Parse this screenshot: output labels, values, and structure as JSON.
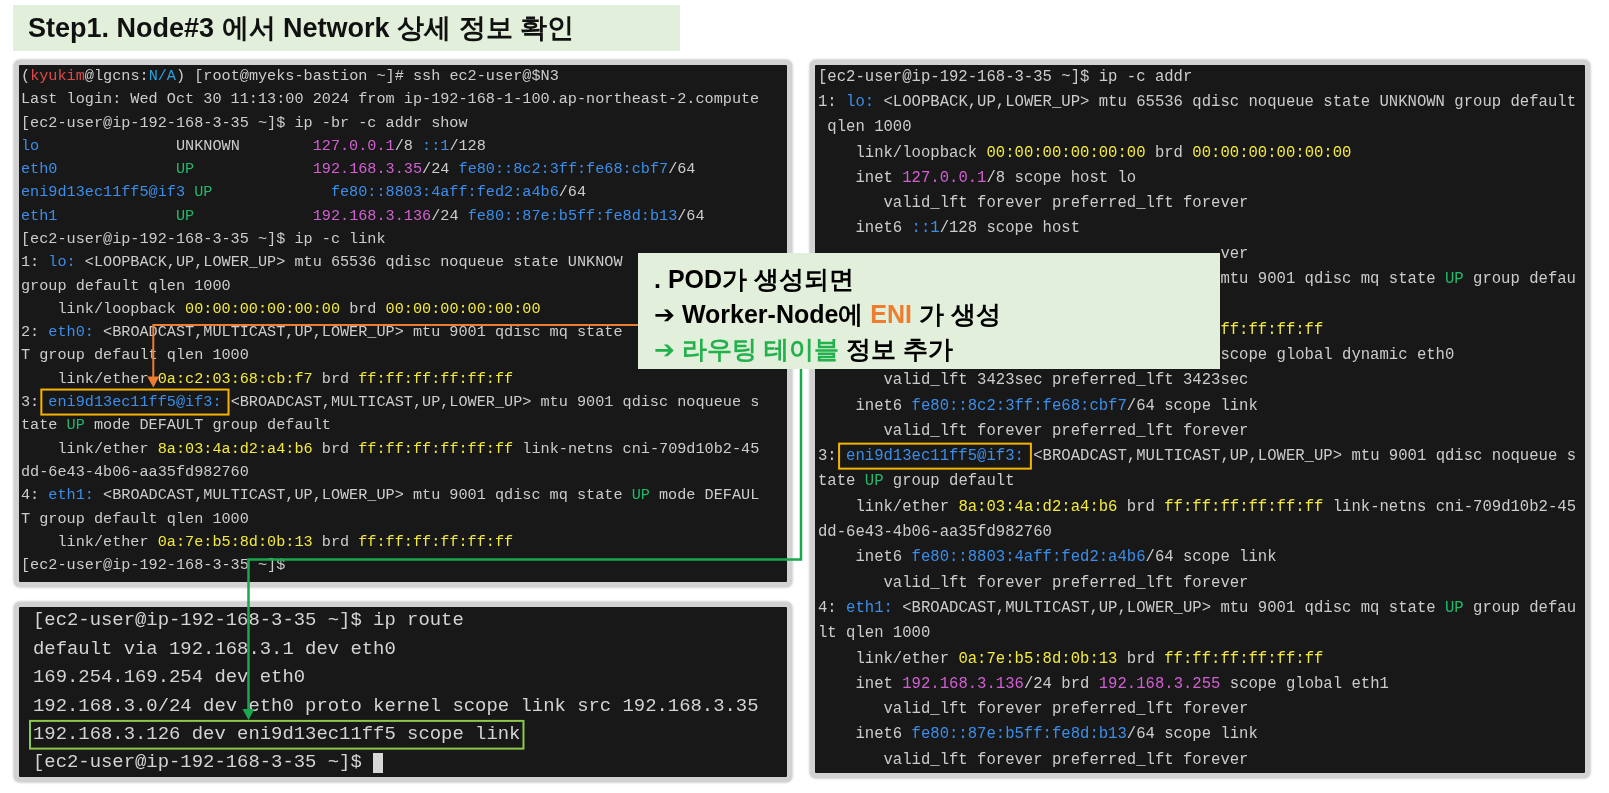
{
  "title": "Step1. Node#3 에서 Network 상세 정보 확인",
  "terminals": [
    {
      "lines": [
        {
          "segments": [
            {
              "text": "("
            },
            {
              "text": "kyukim",
              "color": "#e04a4a"
            },
            {
              "text": "@lgcns:"
            },
            {
              "text": "N/A",
              "color": "#29a0db"
            },
            {
              "text": ") [root@myeks-bastion ~]# ssh ec2-user@$N3"
            }
          ]
        },
        {
          "segments": [
            {
              "text": "Last login: Wed Oct 30 11:13:00 2024 from ip-192-168-1-100.ap-northeast-2.compute"
            }
          ]
        },
        {
          "segments": [
            {
              "text": "[ec2-user@ip-192-168-3-35 ~]$ ip -br -c addr show"
            }
          ]
        },
        {
          "segments": [
            {
              "text": "lo",
              "color": "#3b8eea"
            },
            {
              "text": "               UNKNOWN        "
            },
            {
              "text": "127.0.0.1",
              "color": "#d35fd3"
            },
            {
              "text": "/8 "
            },
            {
              "text": "::1",
              "color": "#3b8eea"
            },
            {
              "text": "/128"
            }
          ]
        },
        {
          "segments": [
            {
              "text": "eth0             ",
              "color": "#3b8eea"
            },
            {
              "text": "UP             ",
              "color": "#23b86a"
            },
            {
              "text": "192.168.3.35",
              "color": "#d35fd3"
            },
            {
              "text": "/24 "
            },
            {
              "text": "fe80::8c2:3ff:fe68:cbf7",
              "color": "#3b8eea"
            },
            {
              "text": "/64"
            }
          ]
        },
        {
          "segments": [
            {
              "text": "eni9d13ec11ff5@if3 ",
              "color": "#3b8eea"
            },
            {
              "text": "UP             ",
              "color": "#23b86a"
            },
            {
              "text": "fe80::8803:4aff:fed2:a4b6",
              "color": "#3b8eea"
            },
            {
              "text": "/64"
            }
          ]
        },
        {
          "segments": [
            {
              "text": "eth1             ",
              "color": "#3b8eea"
            },
            {
              "text": "UP             ",
              "color": "#23b86a"
            },
            {
              "text": "192.168.3.136",
              "color": "#d35fd3"
            },
            {
              "text": "/24 "
            },
            {
              "text": "fe80::87e:b5ff:fe8d:b13",
              "color": "#3b8eea"
            },
            {
              "text": "/64"
            }
          ]
        },
        {
          "segments": [
            {
              "text": "[ec2-user@ip-192-168-3-35 ~]$ ip -c link"
            }
          ]
        },
        {
          "segments": [
            {
              "text": "1: "
            },
            {
              "text": "lo:",
              "color": "#3b8eea"
            },
            {
              "text": " <LOOPBACK,UP,LOWER_UP> mtu 65536 qdisc noqueue state UNKNOW"
            }
          ]
        },
        {
          "segments": [
            {
              "text": "group default qlen 1000"
            }
          ]
        },
        {
          "segments": [
            {
              "text": "    link/loopback "
            },
            {
              "text": "00:00:00:00:00:00",
              "color": "#f2ea3c"
            },
            {
              "text": " brd "
            },
            {
              "text": "00:00:00:00:00:00",
              "color": "#f2ea3c"
            }
          ]
        },
        {
          "segments": [
            {
              "text": "2: "
            },
            {
              "text": "eth0:",
              "color": "#3b8eea"
            },
            {
              "text": " <BROADCAST,MULTICAST,UP,LOWER_UP> mtu 9001 qdisc mq state"
            }
          ]
        },
        {
          "segments": [
            {
              "text": "T group default qlen 1000"
            }
          ]
        },
        {
          "segments": [
            {
              "text": "    link/ether "
            },
            {
              "text": "0a:c2:03:68:cb:f7",
              "color": "#f2ea3c"
            },
            {
              "text": " brd "
            },
            {
              "text": "ff:ff:ff:ff:ff:ff",
              "color": "#f2ea3c"
            }
          ]
        },
        {
          "segments": [
            {
              "text": "3: "
            },
            {
              "text": "eni9d13ec11ff5@if3:",
              "color": "#3b8eea",
              "highlighted": true
            },
            {
              "text": " <BROADCAST,MULTICAST,UP,LOWER_UP> mtu 9001 qdisc noqueue s"
            }
          ]
        },
        {
          "segments": [
            {
              "text": "tate "
            },
            {
              "text": "UP",
              "color": "#23b86a"
            },
            {
              "text": " mode DEFAULT group default"
            }
          ]
        },
        {
          "segments": [
            {
              "text": "    link/ether "
            },
            {
              "text": "8a:03:4a:d2:a4:b6",
              "color": "#f2ea3c"
            },
            {
              "text": " brd "
            },
            {
              "text": "ff:ff:ff:ff:ff:ff",
              "color": "#f2ea3c"
            },
            {
              "text": " link-netns cni-709d10b2-45"
            }
          ]
        },
        {
          "segments": [
            {
              "text": "dd-6e43-4b06-aa35fd982760"
            }
          ]
        },
        {
          "segments": [
            {
              "text": "4: "
            },
            {
              "text": "eth1:",
              "color": "#3b8eea"
            },
            {
              "text": " <BROADCAST,MULTICAST,UP,LOWER_UP> mtu 9001 qdisc mq state "
            },
            {
              "text": "UP",
              "color": "#23b86a"
            },
            {
              "text": " mode DEFAUL"
            }
          ]
        },
        {
          "segments": [
            {
              "text": "T group default qlen 1000"
            }
          ]
        },
        {
          "segments": [
            {
              "text": "    link/ether "
            },
            {
              "text": "0a:7e:b5:8d:0b:13",
              "color": "#f2ea3c"
            },
            {
              "text": " brd "
            },
            {
              "text": "ff:ff:ff:ff:ff:ff",
              "color": "#f2ea3c"
            }
          ]
        },
        {
          "segments": [
            {
              "text": "[ec2-user@ip-192-168-3-35 ~]$"
            }
          ]
        }
      ]
    },
    {
      "lines": [
        {
          "segments": [
            {
              "text": "[ec2-user@ip-192-168-3-35 ~]$ ip route"
            }
          ]
        },
        {
          "segments": [
            {
              "text": "default via 192.168.3.1 dev eth0"
            }
          ]
        },
        {
          "segments": [
            {
              "text": "169.254.169.254 dev eth0"
            }
          ]
        },
        {
          "segments": [
            {
              "text": "192.168.3.0/24 dev eth0 proto kernel scope link src 192.168.3.35"
            }
          ]
        },
        {
          "highlighted": true,
          "segments": [
            {
              "text": "192.168.3.126 dev eni9d13ec11ff5 scope link"
            }
          ]
        },
        {
          "cursor": true,
          "segments": [
            {
              "text": "[ec2-user@ip-192-168-3-35 ~]$ "
            }
          ]
        }
      ]
    },
    {
      "lines": [
        {
          "segments": [
            {
              "text": "[ec2-user@ip-192-168-3-35 ~]$ ip -c addr"
            }
          ]
        },
        {
          "segments": [
            {
              "text": "1: "
            },
            {
              "text": "lo:",
              "color": "#3b8eea"
            },
            {
              "text": " <LOOPBACK,UP,LOWER_UP> mtu 65536 qdisc noqueue state UNKNOWN group default"
            }
          ]
        },
        {
          "segments": [
            {
              "text": " qlen 1000"
            }
          ]
        },
        {
          "segments": [
            {
              "text": "    link/loopback "
            },
            {
              "text": "00:00:00:00:00:00",
              "color": "#f2ea3c"
            },
            {
              "text": " brd "
            },
            {
              "text": "00:00:00:00:00:00",
              "color": "#f2ea3c"
            }
          ]
        },
        {
          "segments": [
            {
              "text": "    inet "
            },
            {
              "text": "127.0.0.1",
              "color": "#d35fd3"
            },
            {
              "text": "/8 scope host lo"
            }
          ]
        },
        {
          "segments": [
            {
              "text": "       valid_lft forever preferred_lft forever"
            }
          ]
        },
        {
          "segments": [
            {
              "text": "    inet6 "
            },
            {
              "text": "::1",
              "color": "#3b8eea"
            },
            {
              "text": "/128 scope host"
            }
          ]
        },
        {
          "kind": "clipped",
          "segments": [
            {
              "text": "ver"
            }
          ]
        },
        {
          "kind": "clipped",
          "segments": [
            {
              "text": "mtu 9001 qdisc mq state "
            },
            {
              "text": "UP",
              "color": "#23b86a"
            },
            {
              "text": " group defau"
            }
          ]
        },
        {
          "kind": "covered"
        },
        {
          "kind": "clipped",
          "segments": [
            {
              "text": "ff:ff:ff:ff",
              "color": "#f2ea3c"
            }
          ]
        },
        {
          "kind": "clipped",
          "segments": [
            {
              "text": "scope global dynamic eth0"
            }
          ]
        },
        {
          "segments": [
            {
              "text": "       valid_lft 3423sec preferred_lft 3423sec"
            }
          ]
        },
        {
          "segments": [
            {
              "text": "    inet6 "
            },
            {
              "text": "fe80::8c2:3ff:fe68:cbf7",
              "color": "#3b8eea"
            },
            {
              "text": "/64 scope link"
            }
          ]
        },
        {
          "segments": [
            {
              "text": "       valid_lft forever preferred_lft forever"
            }
          ]
        },
        {
          "segments": [
            {
              "text": "3: "
            },
            {
              "text": "eni9d13ec11ff5@if3:",
              "color": "#3b8eea",
              "highlighted": true
            },
            {
              "text": " <BROADCAST,MULTICAST,UP,LOWER_UP> mtu 9001 qdisc noqueue s"
            }
          ]
        },
        {
          "segments": [
            {
              "text": "tate "
            },
            {
              "text": "UP",
              "color": "#23b86a"
            },
            {
              "text": " group default"
            }
          ]
        },
        {
          "segments": [
            {
              "text": "    link/ether "
            },
            {
              "text": "8a:03:4a:d2:a4:b6",
              "color": "#f2ea3c"
            },
            {
              "text": " brd "
            },
            {
              "text": "ff:ff:ff:ff:ff:ff",
              "color": "#f2ea3c"
            },
            {
              "text": " link-netns cni-709d10b2-45"
            }
          ]
        },
        {
          "segments": [
            {
              "text": "dd-6e43-4b06-aa35fd982760"
            }
          ]
        },
        {
          "segments": [
            {
              "text": "    inet6 "
            },
            {
              "text": "fe80::8803:4aff:fed2:a4b6",
              "color": "#3b8eea"
            },
            {
              "text": "/64 scope link"
            }
          ]
        },
        {
          "segments": [
            {
              "text": "       valid_lft forever preferred_lft forever"
            }
          ]
        },
        {
          "segments": [
            {
              "text": "4: "
            },
            {
              "text": "eth1:",
              "color": "#3b8eea"
            },
            {
              "text": " <BROADCAST,MULTICAST,UP,LOWER_UP> mtu 9001 qdisc mq state "
            },
            {
              "text": "UP",
              "color": "#23b86a"
            },
            {
              "text": " group defau"
            }
          ]
        },
        {
          "segments": [
            {
              "text": "lt qlen 1000"
            }
          ]
        },
        {
          "segments": [
            {
              "text": "    link/ether "
            },
            {
              "text": "0a:7e:b5:8d:0b:13",
              "color": "#f2ea3c"
            },
            {
              "text": " brd "
            },
            {
              "text": "ff:ff:ff:ff:ff:ff",
              "color": "#f2ea3c"
            }
          ]
        },
        {
          "segments": [
            {
              "text": "    inet "
            },
            {
              "text": "192.168.3.136",
              "color": "#d35fd3"
            },
            {
              "text": "/24 brd "
            },
            {
              "text": "192.168.3.255",
              "color": "#d35fd3"
            },
            {
              "text": " scope global eth1"
            }
          ]
        },
        {
          "segments": [
            {
              "text": "       valid_lft forever preferred_lft forever"
            }
          ]
        },
        {
          "segments": [
            {
              "text": "    inet6 "
            },
            {
              "text": "fe80::87e:b5ff:fe8d:b13",
              "color": "#3b8eea"
            },
            {
              "text": "/64 scope link"
            }
          ]
        },
        {
          "segments": [
            {
              "text": "       valid_lft forever preferred_lft forever"
            }
          ]
        }
      ]
    }
  ],
  "callout": {
    "lines": [
      {
        "segments": [
          {
            "text": ". POD가 생성되면",
            "color": "#000000"
          }
        ]
      },
      {
        "segments": [
          {
            "text": "➔ ",
            "color": "#000000"
          },
          {
            "text": "Worker-Node에 ",
            "color": "#000000"
          },
          {
            "text": "ENI",
            "color": "#ed7d31"
          },
          {
            "text": " 가 생성",
            "color": "#000000"
          }
        ]
      },
      {
        "segments": [
          {
            "text": "➔ ",
            "color": "#22b14c"
          },
          {
            "text": "라우팅 테이블",
            "color": "#22b14c"
          },
          {
            "text": " 정보 추가",
            "color": "#000000"
          }
        ]
      }
    ]
  }
}
